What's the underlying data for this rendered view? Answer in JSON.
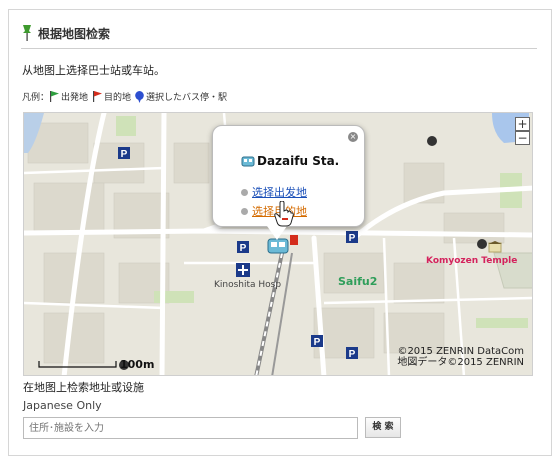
{
  "header": {
    "title": "根据地图检索"
  },
  "instruction": "从地图上选择巴士站或车站。",
  "legend": {
    "prefix": "凡例：",
    "start": "出発地",
    "destination": "目的地",
    "selected": "選択したバス停・駅",
    "colors": {
      "start": "#2e9e3e",
      "destination": "#d42c1c",
      "selected": "#2d4fd0"
    }
  },
  "map": {
    "popup": {
      "title": "Dazaifu Sta.",
      "set_start": "选择出发地",
      "set_destination": "选择目的地",
      "close": "×"
    },
    "labels": {
      "kinoshita": "Kinoshita Hosp",
      "saifu": "Saifu2",
      "temple": "Komyozen Temple",
      "scale": "100m"
    },
    "copyright_line1": "©2015 ZENRIN DataCom",
    "copyright_line2": "地図データ©2015 ZENRIN",
    "zoom_in": "+",
    "zoom_out": "−",
    "parking": "P"
  },
  "search": {
    "heading": "在地图上检索地址或设施",
    "note": "Japanese Only",
    "placeholder": "住所･施設を入力",
    "button": "検 索"
  }
}
